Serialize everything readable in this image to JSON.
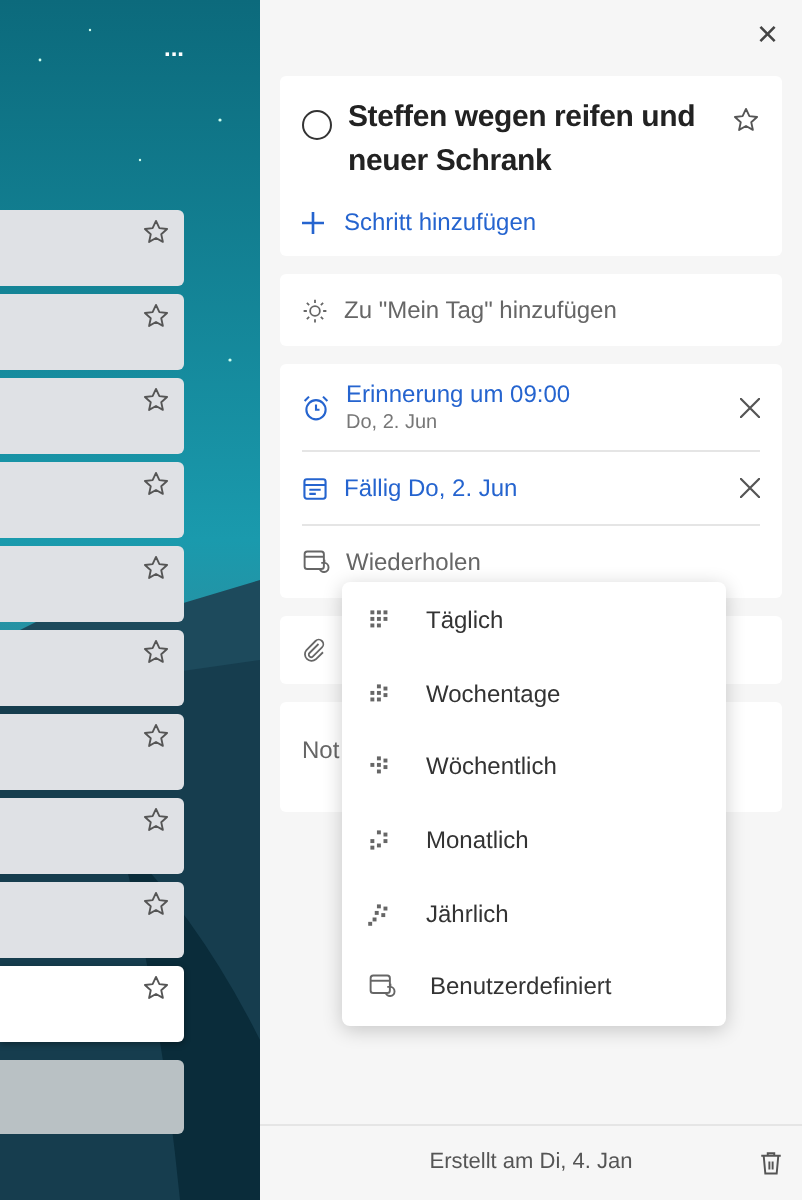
{
  "list_pane": {
    "more_button": "...",
    "tasks": [
      {
        "selected": false
      },
      {
        "selected": false
      },
      {
        "selected": false
      },
      {
        "selected": false
      },
      {
        "selected": false
      },
      {
        "selected": false
      },
      {
        "selected": false
      },
      {
        "selected": false
      },
      {
        "selected": false
      },
      {
        "selected": true
      }
    ]
  },
  "detail": {
    "close": "×",
    "task": {
      "title": "Steffen wegen reifen und neuer Schrank",
      "completed": false,
      "important": false,
      "add_step": "Schritt hinzufügen"
    },
    "my_day": "Zu \"Mein Tag\" hinzufügen",
    "reminder": {
      "title": "Erinnerung um 09:00",
      "date": "Do, 2. Jun"
    },
    "due": "Fällig Do, 2. Jun",
    "repeat": "Wiederholen",
    "note": "Not",
    "footer": "Erstellt am Di, 4. Jan"
  },
  "repeat_menu": [
    {
      "label": "Täglich",
      "kind": "daily"
    },
    {
      "label": "Wochentage",
      "kind": "weekdays"
    },
    {
      "label": "Wöchentlich",
      "kind": "weekly"
    },
    {
      "label": "Monatlich",
      "kind": "monthly"
    },
    {
      "label": "Jährlich",
      "kind": "yearly"
    },
    {
      "label": "Benutzerdefiniert",
      "kind": "custom"
    }
  ]
}
